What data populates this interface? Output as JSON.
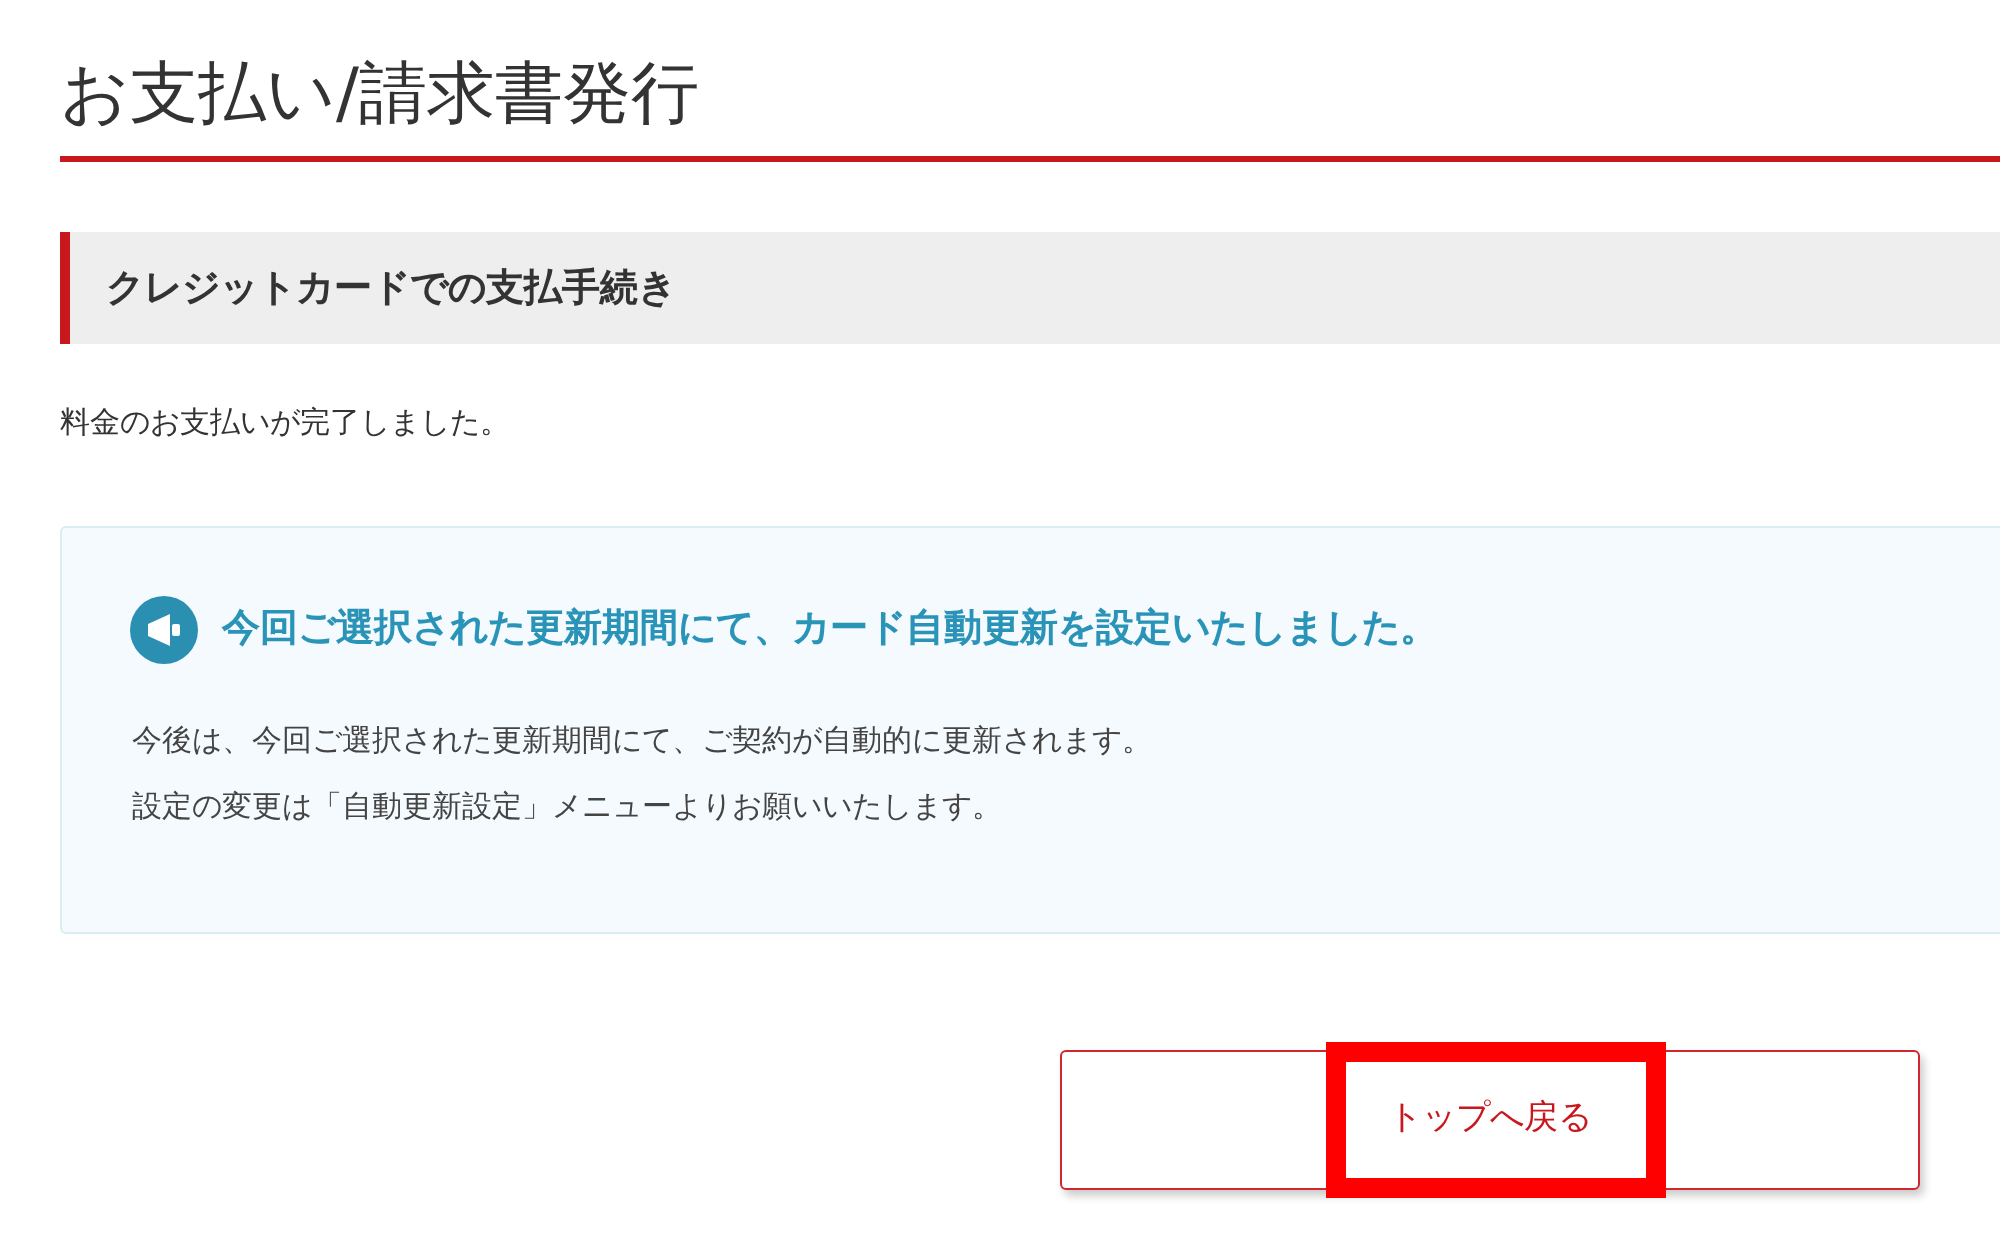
{
  "page_title": "お支払い/請求書発行",
  "section_heading": "クレジットカードでの支払手続き",
  "message": "料金のお支払いが完了しました。",
  "notice": {
    "heading": "今回ご選択された更新期間にて、カード自動更新を設定いたしました。",
    "lines": [
      "今後は、今回ご選択された更新期間にて、ご契約が自動的に更新されます。",
      "設定の変更は「自動更新設定」メニューよりお願いいたします。"
    ]
  },
  "back_button": {
    "label": "トップへ戻る",
    "highlighted": true
  }
}
